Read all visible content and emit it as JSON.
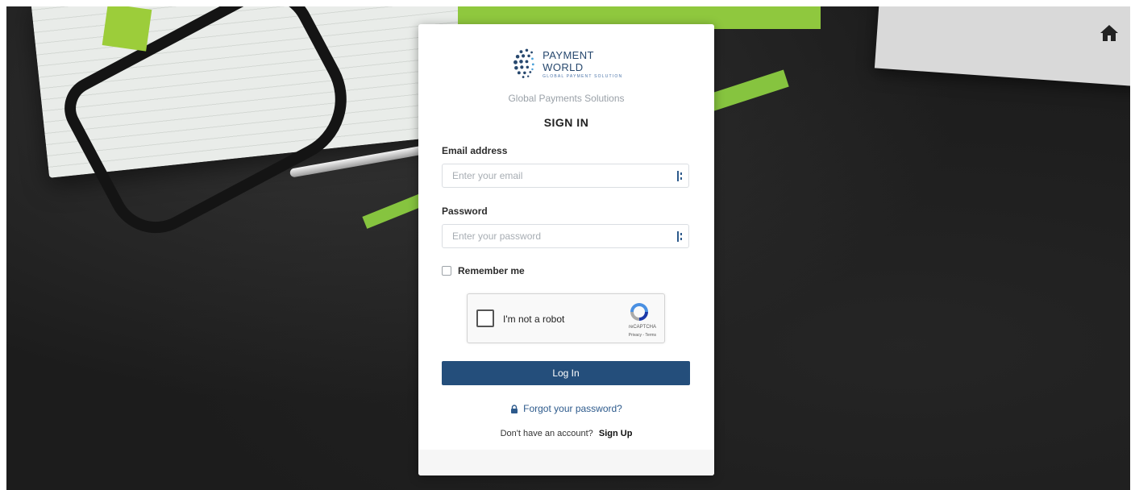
{
  "brand": {
    "logo_title": "PAYMENT WORLD",
    "logo_subtitle": "GLOBAL PAYMENT SOLUTION",
    "tagline": "Global Payments Solutions"
  },
  "form": {
    "heading": "SIGN IN",
    "email_label": "Email address",
    "email_placeholder": "Enter your email",
    "password_label": "Password",
    "password_placeholder": "Enter your password",
    "remember_label": "Remember me",
    "login_label": "Log In",
    "forgot_label": "Forgot your password?",
    "signup_prompt": "Don't have an account?",
    "signup_label": "Sign Up"
  },
  "recaptcha": {
    "label": "I'm not a robot",
    "name": "reCAPTCHA",
    "links": "Privacy - Terms"
  },
  "icons": {
    "home": "home-icon",
    "field_manager": "password-manager-icon",
    "lock": "lock-icon"
  },
  "colors": {
    "primary": "#244e7b",
    "link": "#2d5a8c",
    "brand_text": "#27486e"
  }
}
